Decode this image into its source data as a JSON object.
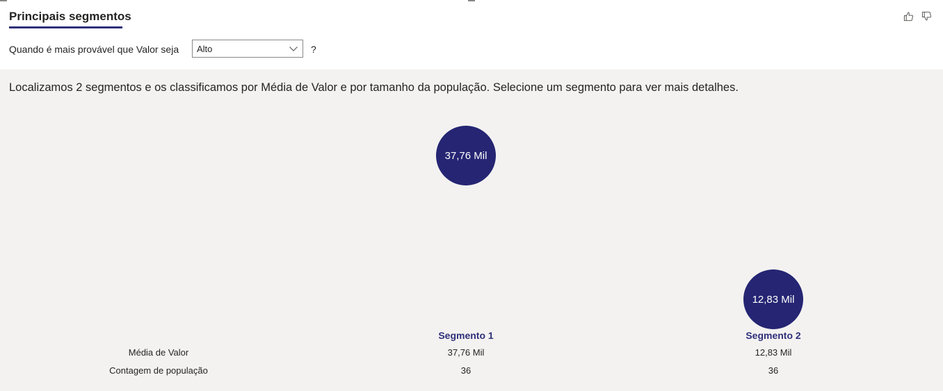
{
  "header": {
    "tab_title": "Principais segmentos",
    "thumbs_up_icon": "thumbs-up-icon",
    "thumbs_down_icon": "thumbs-down-icon"
  },
  "condition": {
    "label": "Quando é mais provável que Valor seja",
    "selected": "Alto",
    "suffix": "?"
  },
  "summary": "Localizamos 2 segmentos e os classificamos por Média de Valor e por tamanho da população. Selecione um segmento para ver mais detalhes.",
  "segments": [
    {
      "name": "Segmento 1",
      "bubble_label": "37,76 Mil",
      "media_valor": "37,76 Mil",
      "contagem": "36"
    },
    {
      "name": "Segmento 2",
      "bubble_label": "12,83 Mil",
      "media_valor": "12,83 Mil",
      "contagem": "36"
    }
  ],
  "row_labels": {
    "media_valor": "Média de Valor",
    "contagem": "Contagem de população"
  },
  "colors": {
    "accent": "#252573",
    "segment_text": "#2f2f7a",
    "panel_bg": "#f3f2f1"
  }
}
